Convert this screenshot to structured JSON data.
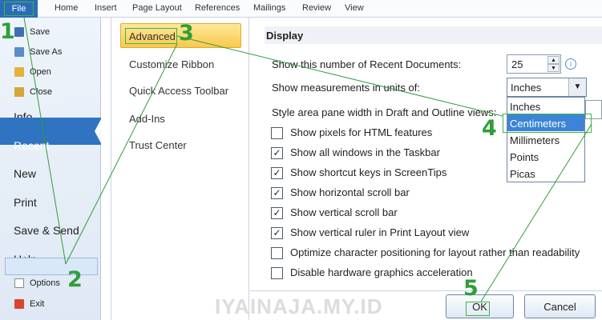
{
  "ribbon": {
    "file_label": "File",
    "tabs": [
      "Home",
      "Insert",
      "Page Layout",
      "References",
      "Mailings",
      "Review",
      "View"
    ]
  },
  "backstage": {
    "small_items": [
      "Save",
      "Save As",
      "Open",
      "Close"
    ],
    "big_items": [
      "Info",
      "Recent",
      "New",
      "Print",
      "Save & Send",
      "Help"
    ],
    "options": "Options",
    "exit": "Exit"
  },
  "categories": {
    "selected": "Advanced",
    "items": [
      "Customize Ribbon",
      "Quick Access Toolbar",
      "Add-Ins",
      "Trust Center"
    ]
  },
  "display": {
    "section": "Display",
    "recent_docs_label": "Show this number of Recent Documents:",
    "recent_docs_value": "25",
    "units_label": "Show measurements in units of:",
    "units_value": "Inches",
    "style_area_label": "Style area pane width in Draft and Outline views:",
    "unit_options": [
      "Inches",
      "Centimeters",
      "Millimeters",
      "Points",
      "Picas"
    ],
    "checkboxes": [
      {
        "label": "Show pixels for HTML features",
        "checked": false
      },
      {
        "label": "Show all windows in the Taskbar",
        "checked": true
      },
      {
        "label": "Show shortcut keys in ScreenTips",
        "checked": true
      },
      {
        "label": "Show horizontal scroll bar",
        "checked": true
      },
      {
        "label": "Show vertical scroll bar",
        "checked": true
      },
      {
        "label": "Show vertical ruler in Print Layout view",
        "checked": true
      },
      {
        "label": "Optimize character positioning for layout rather than readability",
        "checked": false
      },
      {
        "label": "Disable hardware graphics acceleration",
        "checked": false
      }
    ]
  },
  "buttons": {
    "ok": "OK",
    "cancel": "Cancel"
  },
  "steps": [
    "1",
    "2",
    "3",
    "4",
    "5"
  ],
  "watermark": "IYAINAJA.MY.ID",
  "colors": {
    "accent": "#2f73c1",
    "step_green": "#2f9e3a",
    "highlight": "#f9c94e"
  }
}
